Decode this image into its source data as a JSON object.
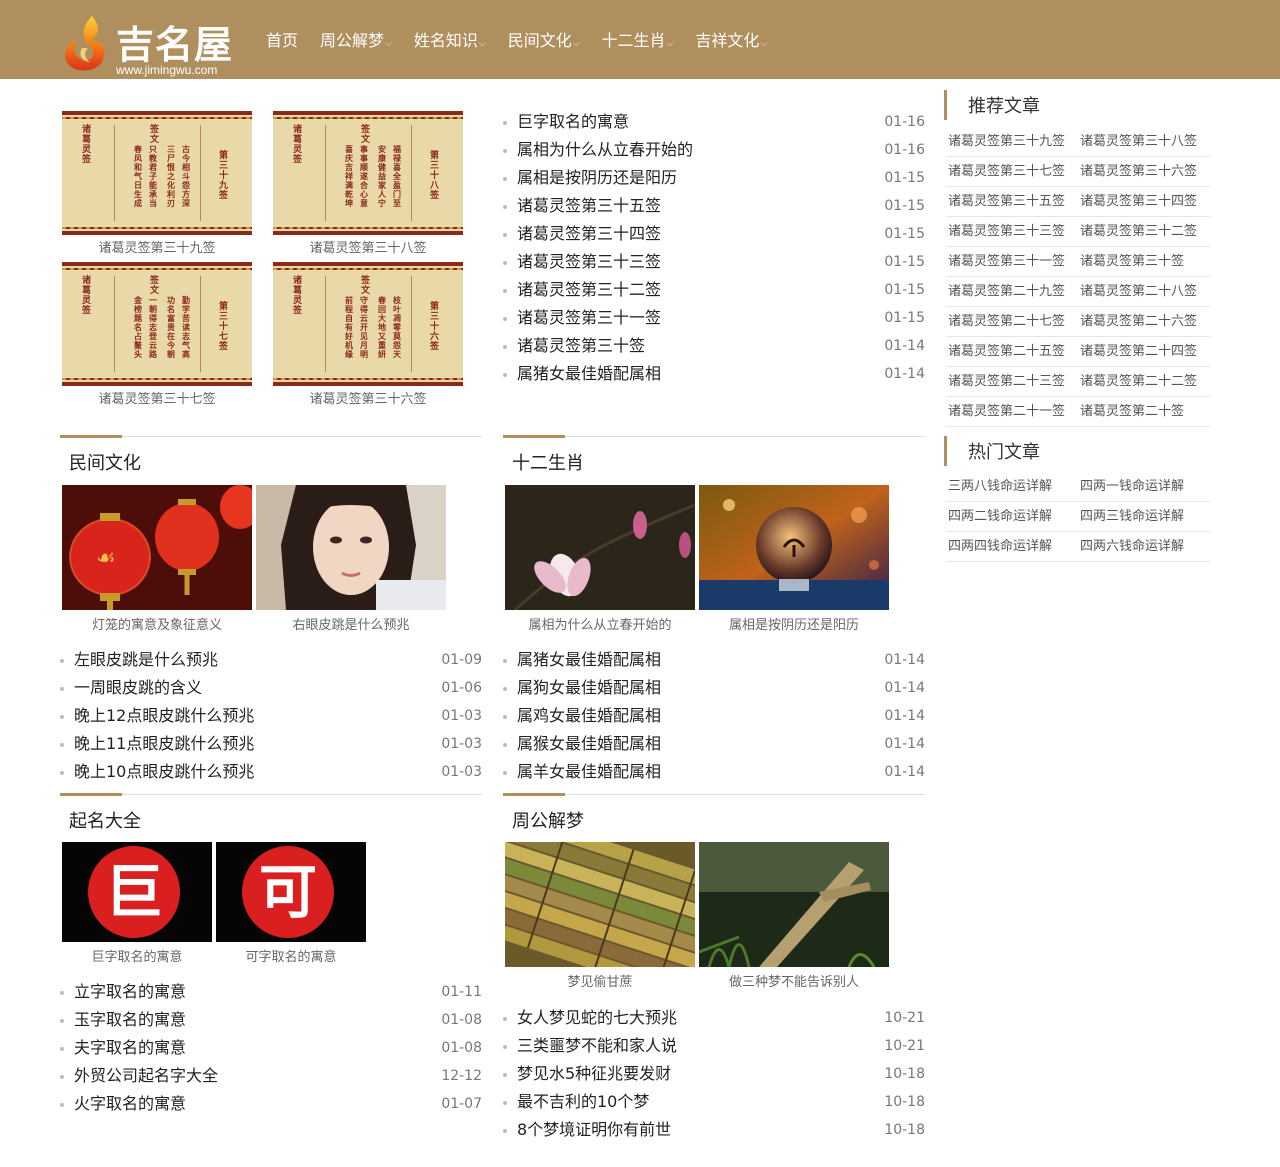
{
  "site": {
    "brand": "吉名屋",
    "domain": "www.jimingwu.com",
    "header_color": "#b08f5f"
  },
  "nav": [
    {
      "label": "首页",
      "dropdown": false
    },
    {
      "label": "周公解梦",
      "dropdown": true
    },
    {
      "label": "姓名知识",
      "dropdown": true
    },
    {
      "label": "民间文化",
      "dropdown": true
    },
    {
      "label": "十二生肖",
      "dropdown": true
    },
    {
      "label": "吉祥文化",
      "dropdown": true
    }
  ],
  "top_gallery": [
    {
      "caption": "诸葛灵签第三十九签",
      "sign": "第三十九签",
      "verse": [
        "古今相斗怨方深",
        "三尸恨之化利刃",
        "只教君子能承当",
        "春风和气日生成"
      ]
    },
    {
      "caption": "诸葛灵签第三十八签",
      "sign": "第三十八签",
      "verse": [
        "福禄喜全盈门至",
        "安康健益家人宁",
        "事事顺遂合心意",
        "喜庆吉祥满乾坤"
      ]
    },
    {
      "caption": "诸葛灵签第三十七签",
      "sign": "第三十七签",
      "verse": [
        "勤学苦读志气高",
        "功名富贵在今朝",
        "一朝得志登云路",
        "金榜题名占鳌头"
      ]
    },
    {
      "caption": "诸葛灵签第三十六签",
      "sign": "第三十六签",
      "verse": [
        "枝叶凋零莫怨天",
        "春回大地又重妍",
        "守得云开见月明",
        "前程自有好机缘"
      ]
    }
  ],
  "sign_header": "诸葛灵签",
  "sign_word": "签文",
  "latest_list": [
    {
      "title": "巨字取名的寓意",
      "date": "01-16"
    },
    {
      "title": "属相为什么从立春开始的",
      "date": "01-16"
    },
    {
      "title": "属相是按阴历还是阳历",
      "date": "01-15"
    },
    {
      "title": "诸葛灵签第三十五签",
      "date": "01-15"
    },
    {
      "title": "诸葛灵签第三十四签",
      "date": "01-15"
    },
    {
      "title": "诸葛灵签第三十三签",
      "date": "01-15"
    },
    {
      "title": "诸葛灵签第三十二签",
      "date": "01-15"
    },
    {
      "title": "诸葛灵签第三十一签",
      "date": "01-15"
    },
    {
      "title": "诸葛灵签第三十签",
      "date": "01-14"
    },
    {
      "title": "属猪女最佳婚配属相",
      "date": "01-14"
    }
  ],
  "sections": {
    "folk": {
      "title": "民间文化",
      "cards": [
        {
          "caption": "灯笼的寓意及象征意义"
        },
        {
          "caption": "右眼皮跳是什么预兆"
        }
      ],
      "list": [
        {
          "title": "左眼皮跳是什么预兆",
          "date": "01-09"
        },
        {
          "title": "一周眼皮跳的含义",
          "date": "01-06"
        },
        {
          "title": "晚上12点眼皮跳什么预兆",
          "date": "01-03"
        },
        {
          "title": "晚上11点眼皮跳什么预兆",
          "date": "01-03"
        },
        {
          "title": "晚上10点眼皮跳什么预兆",
          "date": "01-03"
        }
      ]
    },
    "zodiac": {
      "title": "十二生肖",
      "cards": [
        {
          "caption": "属相为什么从立春开始的"
        },
        {
          "caption": "属相是按阴历还是阳历"
        }
      ],
      "list": [
        {
          "title": "属猪女最佳婚配属相",
          "date": "01-14"
        },
        {
          "title": "属狗女最佳婚配属相",
          "date": "01-14"
        },
        {
          "title": "属鸡女最佳婚配属相",
          "date": "01-14"
        },
        {
          "title": "属猴女最佳婚配属相",
          "date": "01-14"
        },
        {
          "title": "属羊女最佳婚配属相",
          "date": "01-14"
        }
      ]
    },
    "naming": {
      "title": "起名大全",
      "cards": [
        {
          "caption": "巨字取名的寓意",
          "char": "巨"
        },
        {
          "caption": "可字取名的寓意",
          "char": "可"
        }
      ],
      "list": [
        {
          "title": "立字取名的寓意",
          "date": "01-11"
        },
        {
          "title": "玉字取名的寓意",
          "date": "01-08"
        },
        {
          "title": "夫字取名的寓意",
          "date": "01-08"
        },
        {
          "title": "外贸公司起名字大全",
          "date": "12-12"
        },
        {
          "title": "火字取名的寓意",
          "date": "01-07"
        }
      ]
    },
    "dream": {
      "title": "周公解梦",
      "cards": [
        {
          "caption": "梦见偷甘蔗"
        },
        {
          "caption": "做三种梦不能告诉别人"
        }
      ],
      "list": [
        {
          "title": "女人梦见蛇的七大预兆",
          "date": "10-21"
        },
        {
          "title": "三类噩梦不能和家人说",
          "date": "10-21"
        },
        {
          "title": "梦见水5种征兆要发财",
          "date": "10-18"
        },
        {
          "title": "最不吉利的10个梦",
          "date": "10-18"
        },
        {
          "title": "8个梦境证明你有前世",
          "date": "10-18"
        }
      ]
    }
  },
  "sidebar": {
    "recommended_title": "推荐文章",
    "recommended": [
      "诸葛灵签第三十九签",
      "诸葛灵签第三十八签",
      "诸葛灵签第三十七签",
      "诸葛灵签第三十六签",
      "诸葛灵签第三十五签",
      "诸葛灵签第三十四签",
      "诸葛灵签第三十三签",
      "诸葛灵签第三十二签",
      "诸葛灵签第三十一签",
      "诸葛灵签第三十签",
      "诸葛灵签第二十九签",
      "诸葛灵签第二十八签",
      "诸葛灵签第二十七签",
      "诸葛灵签第二十六签",
      "诸葛灵签第二十五签",
      "诸葛灵签第二十四签",
      "诸葛灵签第二十三签",
      "诸葛灵签第二十二签",
      "诸葛灵签第二十一签",
      "诸葛灵签第二十签"
    ],
    "hot_title": "热门文章",
    "hot": [
      "三两八钱命运详解",
      "四两一钱命运详解",
      "四两二钱命运详解",
      "四两三钱命运详解",
      "四两四钱命运详解",
      "四两六钱命运详解"
    ]
  }
}
